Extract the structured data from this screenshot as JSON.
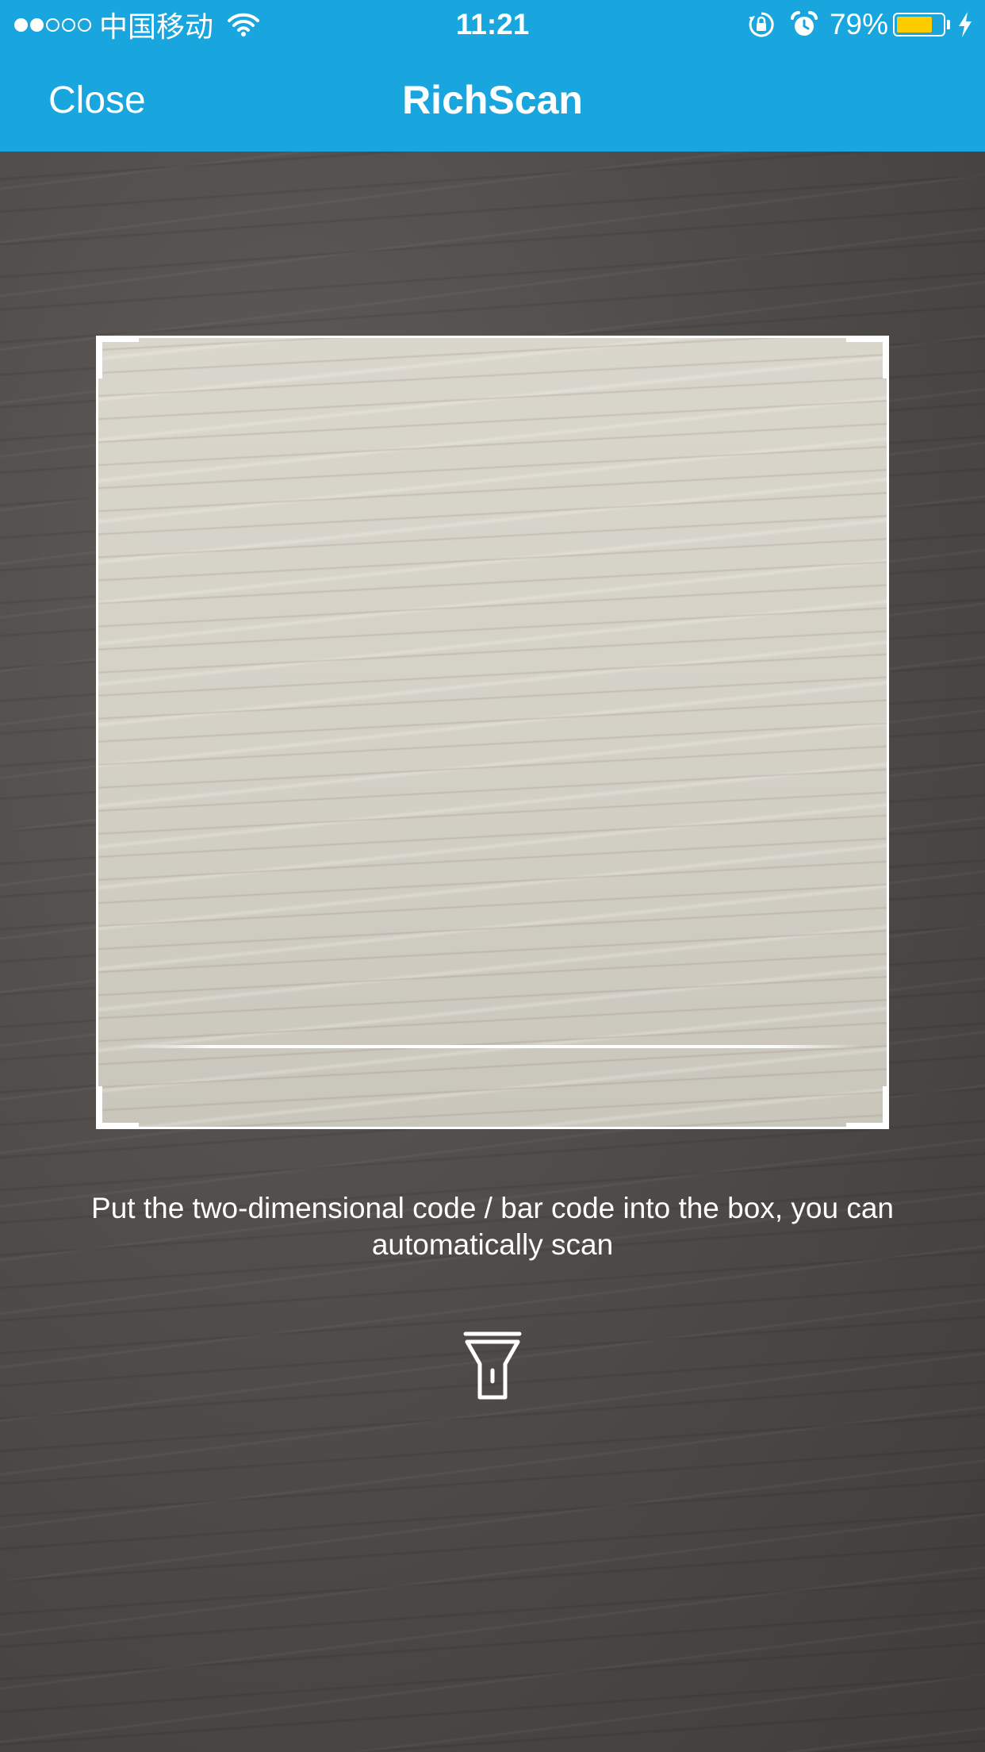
{
  "status_bar": {
    "carrier": "中国移动",
    "signal_bars_filled": 2,
    "signal_bars_total": 5,
    "time": "11:21",
    "battery_percent": "79%",
    "battery_level": 0.79,
    "icons": [
      "wifi-icon",
      "rotation-lock-icon",
      "alarm-icon",
      "battery-icon",
      "charging-bolt-icon"
    ]
  },
  "nav": {
    "close_label": "Close",
    "title": "RichScan"
  },
  "scanner": {
    "hint": "Put the two-dimensional code / bar code into the box, you can automatically scan",
    "torch_icon": "flashlight-icon"
  },
  "colors": {
    "brand_blue": "#19a5de",
    "battery_fill": "#ffcc00",
    "frame": "#ffffff"
  }
}
